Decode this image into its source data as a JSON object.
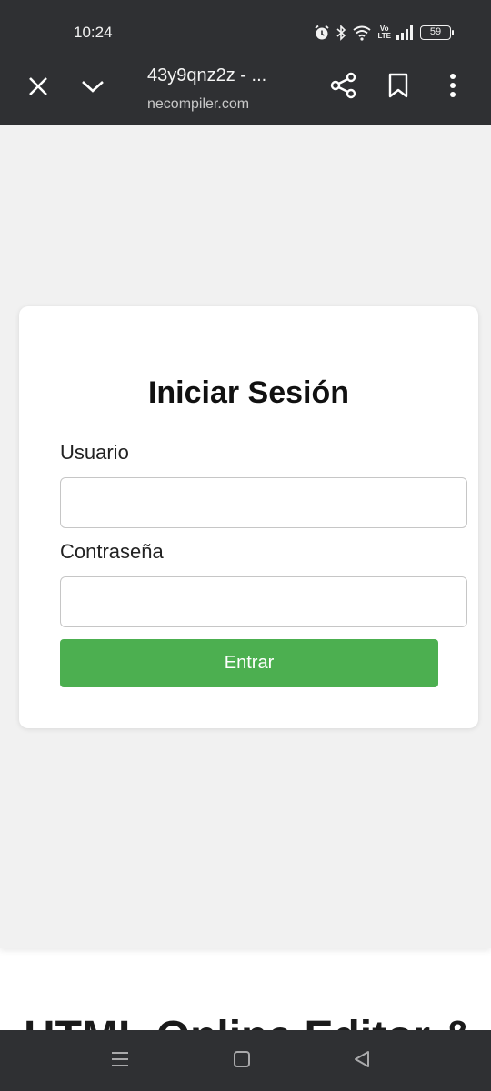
{
  "status_bar": {
    "time": "10:24",
    "volte_label_top": "Vo",
    "volte_label_bottom": "LTE",
    "battery_level": "59",
    "icons": [
      "alarm-icon",
      "bluetooth-icon",
      "wifi-icon",
      "volte-icon",
      "signal-icon",
      "battery-icon"
    ]
  },
  "browser_bar": {
    "page_title": "43y9qnz2z - ...",
    "page_url": "necompiler.com",
    "icons": [
      "close-icon",
      "chevron-down-icon",
      "share-icon",
      "bookmark-icon",
      "more-vert-icon"
    ]
  },
  "login": {
    "title": "Iniciar Sesión",
    "username_label": "Usuario",
    "username_value": "",
    "password_label": "Contraseña",
    "password_value": "",
    "submit_label": "Entrar"
  },
  "page_below": {
    "heading": "HTML Online Editor &"
  },
  "nav_bar": {
    "icons": [
      "recent-apps-icon",
      "home-icon",
      "back-icon"
    ]
  },
  "colors": {
    "system_bar": "#2f3033",
    "preview_background": "#f1f1f1",
    "card_background": "#ffffff",
    "submit_button": "#4caf50",
    "submit_text": "#ffffff"
  }
}
